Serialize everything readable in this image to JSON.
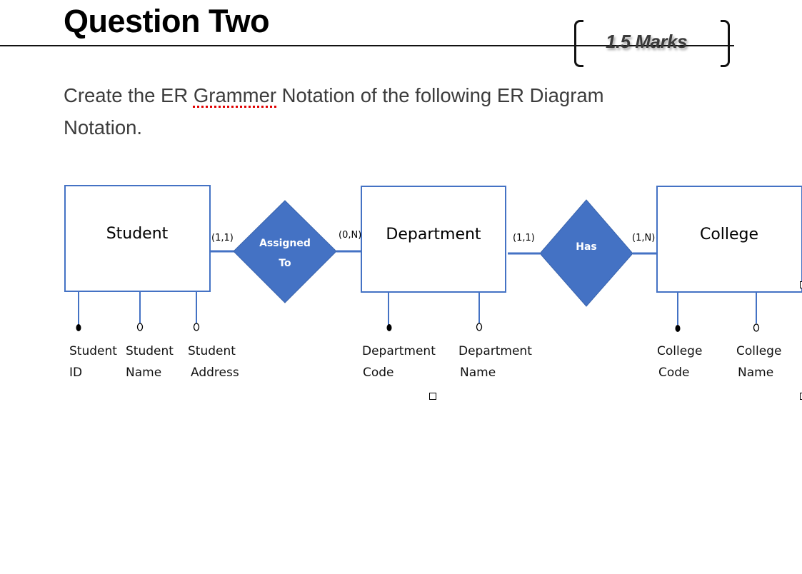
{
  "question": {
    "title": "Question Two",
    "marks": "1.5 Marks",
    "instruction_parts": [
      "Create the ER ",
      "Grammer",
      " Notation of the following ER Diagram Notation."
    ]
  },
  "colors": {
    "entity_border": "#4472c4",
    "relationship_fill": "#4472c4",
    "spellcheck_underline": "#e00000"
  },
  "diagram": {
    "entities": [
      {
        "name": "Student",
        "attributes": [
          {
            "line1": "Student",
            "line2": "ID",
            "key": true
          },
          {
            "line1": "Student",
            "line2": "Name",
            "key": false
          },
          {
            "line1": "Student",
            "line2": "Address",
            "key": false
          }
        ]
      },
      {
        "name": "Department",
        "attributes": [
          {
            "line1": "Department",
            "line2": "Code",
            "key": true
          },
          {
            "line1": "Department",
            "line2": "Name",
            "key": false
          }
        ]
      },
      {
        "name": "College",
        "attributes": [
          {
            "line1": "College",
            "line2": "Code",
            "key": true
          },
          {
            "line1": "College",
            "line2": "Name",
            "key": false
          }
        ]
      }
    ],
    "relationships": [
      {
        "line1": "Assigned",
        "line2": "To",
        "left_cardinality": "(1,1)",
        "right_cardinality": "(0,N)"
      },
      {
        "line1": "Has",
        "line2": "",
        "left_cardinality": "(1,1)",
        "right_cardinality": "(1,N)"
      }
    ]
  }
}
